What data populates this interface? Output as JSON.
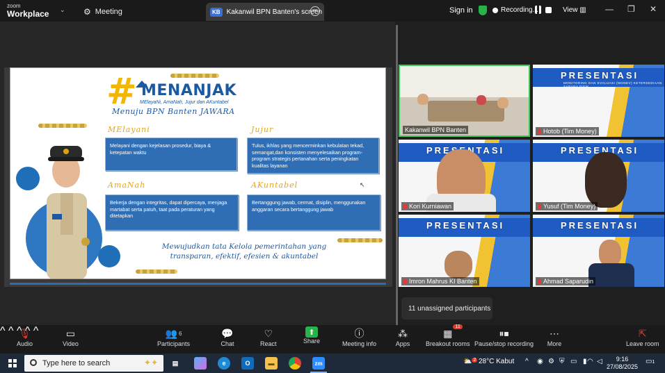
{
  "app": {
    "brand_small": "zoom",
    "brand_big": "Workplace",
    "meeting_label": "Meeting",
    "screen_tab_initials": "KB",
    "screen_tab_title": "Kakanwil BPN Banten's screen",
    "sign_in": "Sign in",
    "recording_label": "Recording...",
    "view_label": "View"
  },
  "slide": {
    "hash": "#",
    "headline": "MENANJAK",
    "headline_sub": "MElayaNi, AmaNah, Jujur dan AKuntabel",
    "menuju": "Menuju BPN Banten JAWARA",
    "sections": [
      {
        "heading": "MElayani",
        "text": "Melayani dengan kejelasan prosedur, biaya & ketepatan waktu"
      },
      {
        "heading": "Jujur",
        "text": "Tulus, ikhlas yang mencerminkan kebulatan tekad, semangat,dan konsisten menyelesaikan program-program strategis pertanahan serta peningkatan kualitas layanan"
      },
      {
        "heading": "AmaNah",
        "text": "Bekerja dengan integritas, dapat dipercaya, menjaga martabat serta patuh, taat pada peraturan yang ditetapkan"
      },
      {
        "heading": "AKuntabel",
        "text": "Bertanggung jawab, cermat, disiplin, menggunakan anggaran secara bertanggung jawab"
      }
    ],
    "tagline_line1": "Mewujudkan tata Kelola pemerintahan yang",
    "tagline_line2": "transparan, efektif, efesien & akuntabel"
  },
  "gallery": {
    "presentasi_title": "PRESENTASI",
    "presentasi_sub": "MONITORING DAN EVALUASI (MONEV) KETERSEDIAAN SARANA FISIK",
    "tiles": [
      {
        "name": "Kakanwil BPN Banten"
      },
      {
        "name": "Hotob (Tim Money)"
      },
      {
        "name": "Kori Kurniawan"
      },
      {
        "name": "Yusuf (Tim Money)"
      },
      {
        "name": "Imron Mahrus KI Banten"
      },
      {
        "name": "Ahmad Saparudin"
      }
    ]
  },
  "tooltip": "11 unassigned participants",
  "toolbar": {
    "audio": "Audio",
    "video": "Video",
    "participants": "Participants",
    "participants_count": "6",
    "chat": "Chat",
    "react": "React",
    "share": "Share",
    "meeting_info": "Meeting info",
    "apps": "Apps",
    "breakout_rooms": "Breakout rooms",
    "breakout_badge": "11",
    "pause_stop": "Pause/stop recording",
    "more": "More",
    "leave": "Leave room"
  },
  "taskbar": {
    "search_placeholder": "Type here to search",
    "weather_badge": "2",
    "weather": "28°C  Kabut",
    "time": "9:16",
    "date": "27/08/2025",
    "notif_count": "1"
  },
  "colors": {
    "accent_blue": "#2f6db4",
    "gold": "#e0a526",
    "recording_red": "#e0392b",
    "active_green": "#27b34a"
  }
}
